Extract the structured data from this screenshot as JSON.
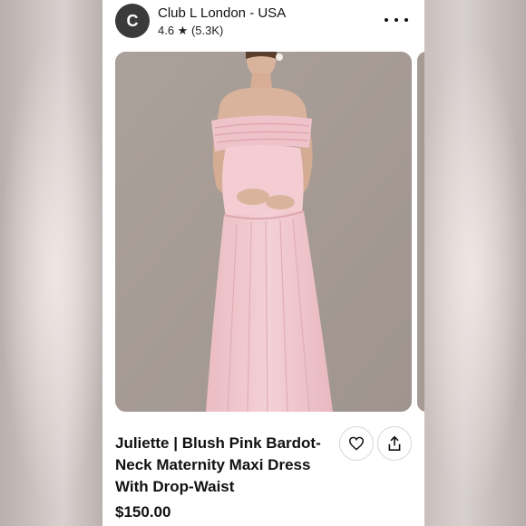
{
  "seller": {
    "avatar_letter": "C",
    "name": "Club L London - USA",
    "rating": "4.6 ★ (5.3K)"
  },
  "product": {
    "title": "Juliette | Blush Pink Bardot-Neck Maternity Maxi Dress With Drop-Waist",
    "price": "$150.00"
  },
  "icons": {
    "more": "more-options-icon",
    "favorite": "heart-icon",
    "share": "share-icon"
  },
  "colors": {
    "dress": "#f1c9cf",
    "photo_background": "#a99e97"
  }
}
